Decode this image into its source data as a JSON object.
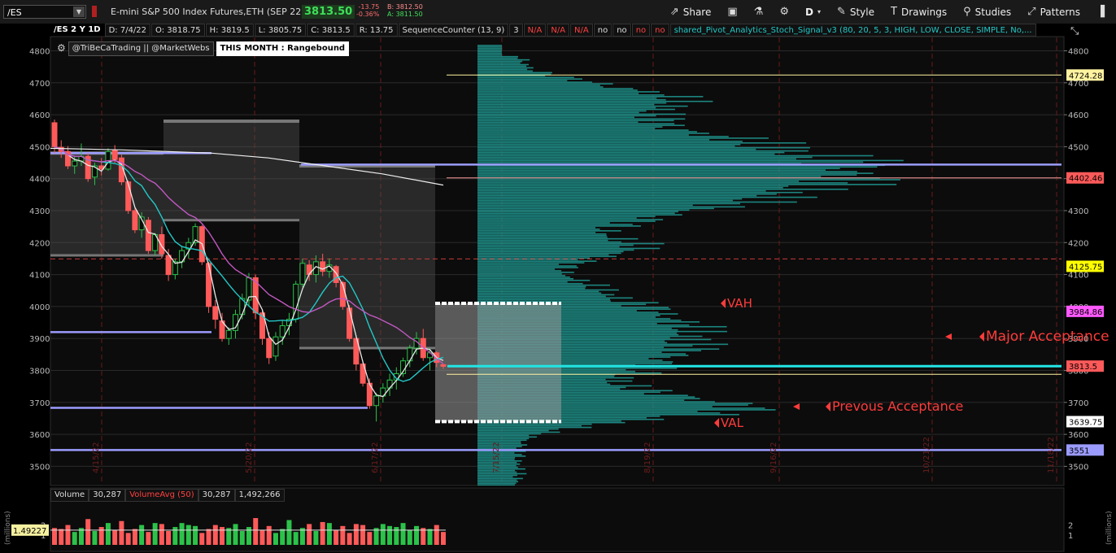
{
  "toolbar": {
    "symbol": "/ES",
    "instrument": "E-mini S&P 500 Index Futures,ETH (SEP 22)",
    "last": "3813.50",
    "change": "-13.75",
    "change_pct": "-0.36%",
    "bid": "B: 3812.50",
    "ask": "A: 3811.50",
    "share": "Share",
    "period": "D",
    "style": "Style",
    "drawings": "Drawings",
    "studies": "Studies",
    "patterns": "Patterns"
  },
  "header": {
    "symbol_period": "/ES 2 Y 1D",
    "date": "D: 7/4/22",
    "open": "O: 3818.75",
    "high": "H: 3819.5",
    "low": "L: 3805.75",
    "close": "C: 3813.5",
    "range": "R: 13.75",
    "study1": "SequenceCounter (13, 9)",
    "study1_vals": [
      "3",
      "N/A",
      "N/A",
      "N/A",
      "no",
      "no",
      "no",
      "no"
    ],
    "study2": "shared_Pivot_Analytics_Stoch_Signal_v3 (80, 20, 5, 3, HIGH, LOW, CLOSE, SIMPLE, No,..."
  },
  "tags": [
    "@TriBeCaTrading || @MarketWebs",
    "THIS MONTH : Rangebound"
  ],
  "volume_header": {
    "label": "Volume",
    "value": "30,287",
    "avg_label": "VolumeAvg (50)",
    "avg_value": "30,287",
    "avg2": "1,492,266"
  },
  "chart_data": {
    "type": "candlestick",
    "y_range": [
      3430,
      4825
    ],
    "y_ticks": [
      3500,
      3600,
      3700,
      3800,
      3900,
      4000,
      4100,
      4200,
      4300,
      4400,
      4500,
      4600,
      4700,
      4800
    ],
    "date_labels": [
      "4/15/22",
      "5/20/22",
      "6/17/22",
      "7/15/22",
      "8/19/22",
      "9/16/22",
      "10/21/22",
      "11/18/22"
    ],
    "candles": [
      [
        4575,
        4585,
        4480,
        4500
      ],
      [
        4498,
        4520,
        4465,
        4485
      ],
      [
        4485,
        4502,
        4430,
        4440
      ],
      [
        4440,
        4470,
        4415,
        4455
      ],
      [
        4455,
        4510,
        4440,
        4470
      ],
      [
        4470,
        4480,
        4390,
        4400
      ],
      [
        4405,
        4450,
        4380,
        4440
      ],
      [
        4440,
        4465,
        4410,
        4430
      ],
      [
        4430,
        4495,
        4425,
        4485
      ],
      [
        4488,
        4505,
        4450,
        4460
      ],
      [
        4465,
        4475,
        4380,
        4390
      ],
      [
        4390,
        4395,
        4290,
        4300
      ],
      [
        4300,
        4310,
        4230,
        4240
      ],
      [
        4240,
        4295,
        4215,
        4280
      ],
      [
        4270,
        4280,
        4165,
        4175
      ],
      [
        4175,
        4230,
        4160,
        4225
      ],
      [
        4225,
        4250,
        4150,
        4165
      ],
      [
        4160,
        4180,
        4080,
        4100
      ],
      [
        4100,
        4150,
        4085,
        4140
      ],
      [
        4140,
        4190,
        4120,
        4175
      ],
      [
        4180,
        4215,
        4150,
        4200
      ],
      [
        4200,
        4260,
        4190,
        4250
      ],
      [
        4250,
        4255,
        4130,
        4140
      ],
      [
        4135,
        4140,
        3980,
        4000
      ],
      [
        4000,
        4020,
        3930,
        3960
      ],
      [
        3955,
        3980,
        3890,
        3900
      ],
      [
        3900,
        3935,
        3880,
        3925
      ],
      [
        3925,
        3990,
        3900,
        3975
      ],
      [
        3975,
        4040,
        3960,
        4025
      ],
      [
        4020,
        4105,
        4000,
        4090
      ],
      [
        4090,
        4100,
        3960,
        3980
      ],
      [
        3980,
        3990,
        3880,
        3900
      ],
      [
        3900,
        3920,
        3820,
        3840
      ],
      [
        3845,
        3920,
        3830,
        3905
      ],
      [
        3905,
        3955,
        3880,
        3940
      ],
      [
        3940,
        3980,
        3910,
        3960
      ],
      [
        3960,
        4080,
        3950,
        4070
      ],
      [
        4070,
        4150,
        4060,
        4135
      ],
      [
        4130,
        4145,
        4080,
        4100
      ],
      [
        4100,
        4160,
        4075,
        4140
      ],
      [
        4140,
        4165,
        4095,
        4110
      ],
      [
        4110,
        4150,
        4090,
        4130
      ],
      [
        4125,
        4130,
        4060,
        4075
      ],
      [
        4075,
        4080,
        3990,
        4000
      ],
      [
        3995,
        4005,
        3890,
        3900
      ],
      [
        3900,
        3910,
        3800,
        3820
      ],
      [
        3820,
        3830,
        3750,
        3760
      ],
      [
        3760,
        3775,
        3680,
        3690
      ],
      [
        3690,
        3730,
        3640,
        3720
      ],
      [
        3720,
        3760,
        3700,
        3745
      ],
      [
        3745,
        3790,
        3720,
        3770
      ],
      [
        3770,
        3810,
        3740,
        3790
      ],
      [
        3790,
        3840,
        3780,
        3830
      ],
      [
        3830,
        3880,
        3810,
        3870
      ],
      [
        3870,
        3920,
        3850,
        3900
      ],
      [
        3900,
        3930,
        3830,
        3840
      ],
      [
        3840,
        3870,
        3800,
        3855
      ],
      [
        3855,
        3860,
        3810,
        3825
      ],
      [
        3818,
        3819,
        3805,
        3813
      ]
    ],
    "price_levels": [
      {
        "label": "4724.28",
        "value": 4724.28,
        "color": "#fff3a0"
      },
      {
        "label": "4402.46",
        "value": 4402.46,
        "color": "#ff5a5a"
      },
      {
        "label": "4125.75",
        "value": 4125.75,
        "color": "#ffff00"
      },
      {
        "label": "3984.86",
        "value": 3984.86,
        "color": "#ff59ff"
      },
      {
        "label": "3813.5",
        "value": 3813.5,
        "color": "#ff5a5a"
      },
      {
        "label": "3639.75",
        "value": 3639.75,
        "color": "#ffffff"
      },
      {
        "label": "3551",
        "value": 3551,
        "color": "#9b9bff"
      }
    ],
    "annotations": [
      "VAH",
      "Major Acceptance",
      "Prevous Acceptance",
      "VAL"
    ],
    "volume_ticks": [
      1,
      2
    ],
    "volume_avg_label": "1.49227",
    "volume_axis_label": "millions"
  },
  "colors": {
    "up": "#2cc24a",
    "down": "#ff5a5a",
    "profile": "#1e8c86",
    "ma_white": "#e8e8e8",
    "ma_cyan": "#22c8c8",
    "ma_magenta": "#c258c2",
    "pivot_lavender": "#9c9cff",
    "accent_red": "#ff3b3b"
  }
}
